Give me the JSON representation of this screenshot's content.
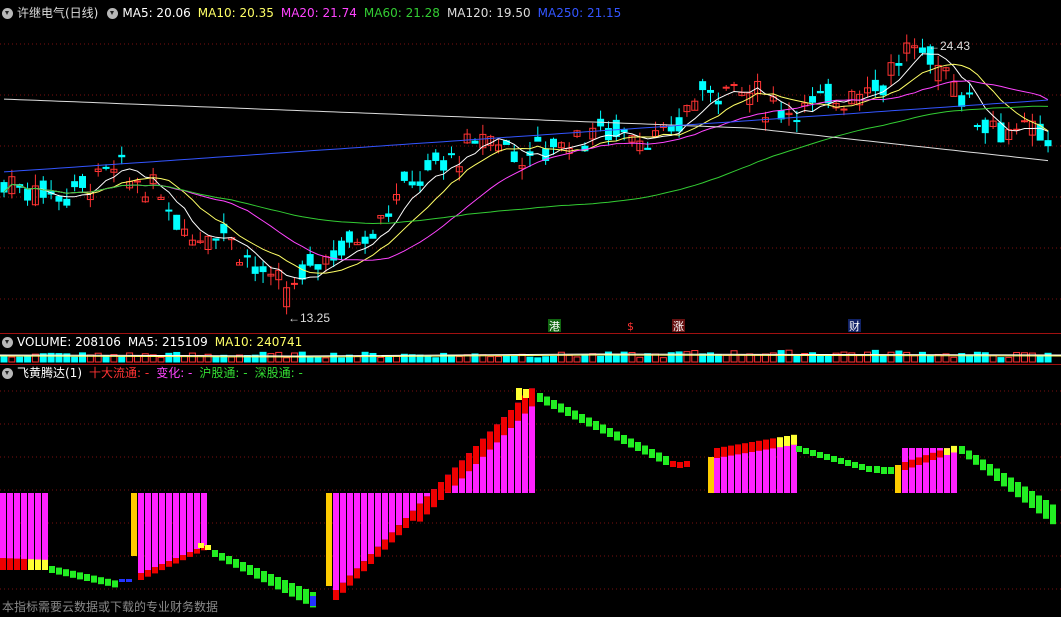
{
  "price_panel": {
    "stock_name": "许继电气(日线)",
    "ma_labels": [
      {
        "text": "MA5: 20.06",
        "color": "#ffffff"
      },
      {
        "text": "MA10: 20.35",
        "color": "#ffff66"
      },
      {
        "text": "MA20: 21.74",
        "color": "#ff44ff"
      },
      {
        "text": "MA60: 21.28",
        "color": "#33cc33"
      },
      {
        "text": "MA120: 19.50",
        "color": "#dddddd"
      },
      {
        "text": "MA250: 21.15",
        "color": "#3355ff"
      }
    ],
    "high_label": "24.43",
    "low_label": "13.25",
    "event_markers": [
      {
        "text": "港",
        "bg": "#116611",
        "fg": "#ffffff"
      },
      {
        "text": "$",
        "bg": "#000000",
        "fg": "#ff3333"
      },
      {
        "text": "涨",
        "bg": "#661111",
        "fg": "#ffffff"
      },
      {
        "text": "财",
        "bg": "#112266",
        "fg": "#ffffff"
      }
    ]
  },
  "volume_panel": {
    "labels": [
      {
        "text": "VOLUME: 208106",
        "color": "#ffffff"
      },
      {
        "text": "MA5: 215109",
        "color": "#ffffff"
      },
      {
        "text": "MA10: 240741",
        "color": "#ffff66"
      }
    ]
  },
  "indicator_panel": {
    "labels": [
      {
        "text": "飞黄腾达(1)",
        "color": "#ffffff"
      },
      {
        "text": "十大流通: -",
        "color": "#ff3333"
      },
      {
        "text": "变化: -",
        "color": "#ff44ff"
      },
      {
        "text": "沪股通: -",
        "color": "#33dd33"
      },
      {
        "text": "深股通: -",
        "color": "#33dd33"
      }
    ]
  },
  "footer_text": "本指标需要云数据或下载的专业财务数据",
  "colors": {
    "up": "#ff3333",
    "down": "#00ffff",
    "ma5": "#ffffff",
    "ma10": "#ffff66",
    "ma20": "#ff44ff",
    "ma60": "#33cc33",
    "ma120": "#dddddd",
    "ma250": "#3355ff"
  }
}
